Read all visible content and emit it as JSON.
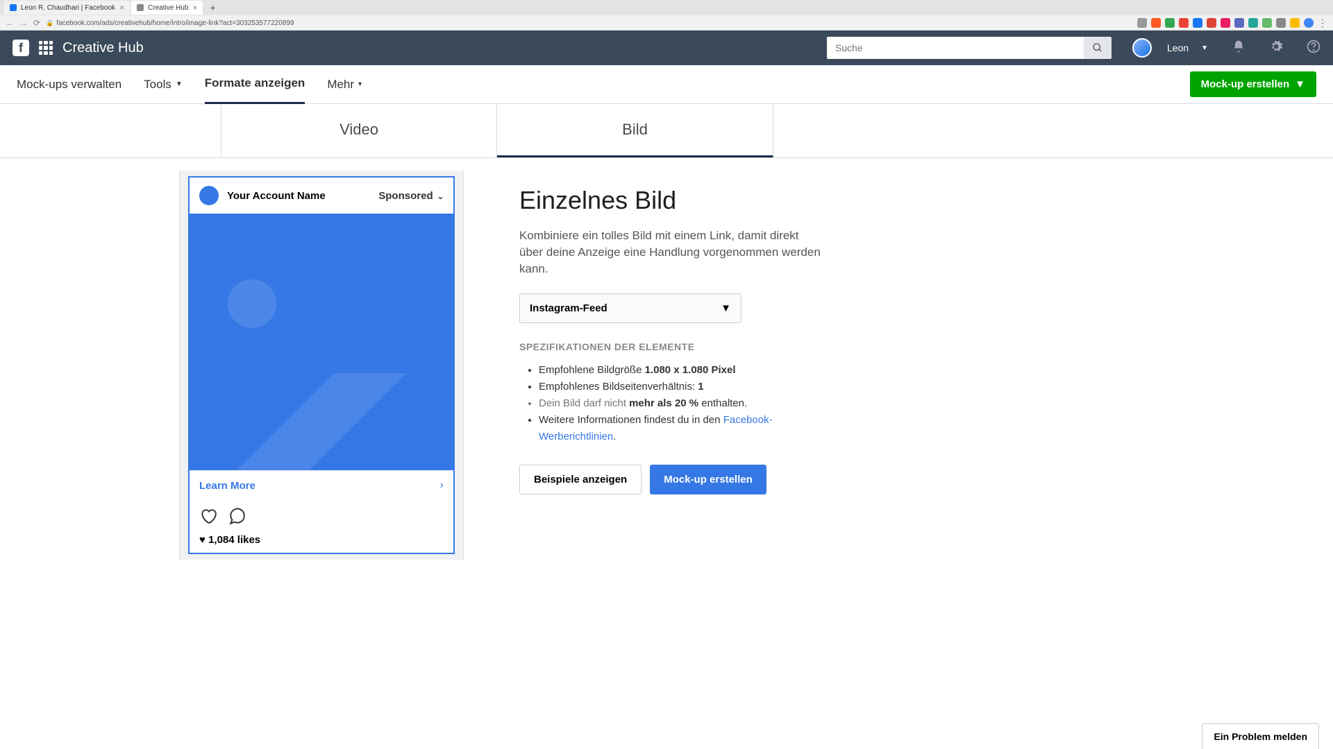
{
  "browser": {
    "tabs": [
      {
        "label": "Leon R. Chaudhari | Facebook",
        "active": false
      },
      {
        "label": "Creative Hub",
        "active": true
      }
    ],
    "url": "facebook.com/ads/creativehub/home/intro/image-link?act=303253577220899"
  },
  "header": {
    "title": "Creative Hub",
    "search_placeholder": "Suche",
    "username": "Leon"
  },
  "subnav": {
    "manage": "Mock-ups verwalten",
    "tools": "Tools",
    "formats": "Formate anzeigen",
    "more": "Mehr",
    "create_button": "Mock-up erstellen"
  },
  "format_tabs": {
    "video": "Video",
    "image": "Bild"
  },
  "preview": {
    "account": "Your Account Name",
    "sponsored": "Sponsored",
    "cta": "Learn More",
    "likes": "1,084 likes"
  },
  "detail": {
    "title": "Einzelnes Bild",
    "description": "Kombiniere ein tolles Bild mit einem Link, damit direkt über deine Anzeige eine Handlung vorgenommen werden kann.",
    "dropdown": "Instagram-Feed",
    "spec_title": "SPEZIFIKATIONEN DER ELEMENTE",
    "spec1_prefix": "Empfohlene Bildgröße ",
    "spec1_bold": "1.080 x 1.080 Pixel",
    "spec2_prefix": "Empfohlenes Bildseitenverhältnis: ",
    "spec2_bold": "1",
    "spec3_prefix": "Dein Bild darf nicht ",
    "spec3_bold": "mehr als 20 %",
    "spec3_suffix": " enthalten.",
    "spec4_prefix": "Weitere Informationen findest du in den ",
    "spec4_link": "Facebook-Werberichtlinien",
    "spec4_suffix": ".",
    "examples_button": "Beispiele anzeigen",
    "create_button": "Mock-up erstellen"
  },
  "footer": {
    "report": "Ein Problem melden"
  }
}
